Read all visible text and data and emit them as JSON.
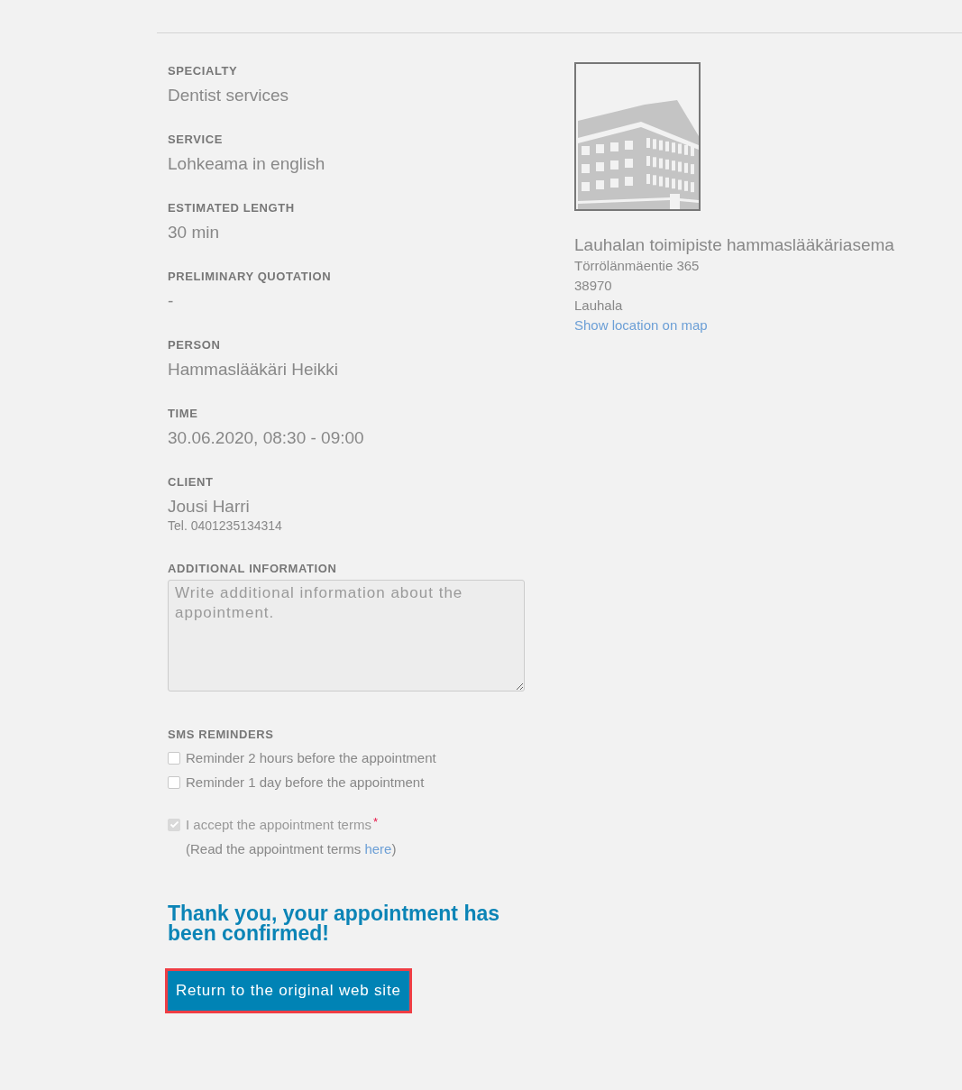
{
  "details": [
    {
      "label": "SPECIALTY",
      "value": "Dentist services"
    },
    {
      "label": "SERVICE",
      "value": "Lohkeama in english"
    },
    {
      "label": "ESTIMATED LENGTH",
      "value": "30 min"
    },
    {
      "label": "PRELIMINARY QUOTATION",
      "value": "-"
    },
    {
      "label": "PERSON",
      "value": "Hammaslääkäri Heikki"
    },
    {
      "label": "TIME",
      "value": "30.06.2020, 08:30 - 09:00"
    }
  ],
  "client": {
    "label": "CLIENT",
    "name": "Jousi Harri",
    "phone": "Tel. 0401235134314"
  },
  "additional_info": {
    "label": "ADDITIONAL INFORMATION",
    "placeholder": "Write additional information about the appointment."
  },
  "sms_reminders": {
    "label": "SMS REMINDERS",
    "options": [
      {
        "label": "Reminder 2 hours before the appointment",
        "checked": false
      },
      {
        "label": "Reminder 1 day before the appointment",
        "checked": false
      }
    ]
  },
  "terms": {
    "label": "I accept the appointment terms",
    "required_mark": "*",
    "checked": true,
    "disabled": true,
    "note_prefix": "(Read the appointment terms ",
    "link": "here",
    "note_suffix": ")"
  },
  "confirmation": "Thank you, your appointment has been confirmed!",
  "return_button": {
    "label": "Return to the original web site",
    "highlighted": true
  },
  "location": {
    "name": "Lauhalan toimipiste hammaslääkäriasema",
    "street": "Törrölänmäentie 365",
    "postal_code": "38970",
    "city": "Lauhala",
    "map_link": "Show location on map"
  }
}
